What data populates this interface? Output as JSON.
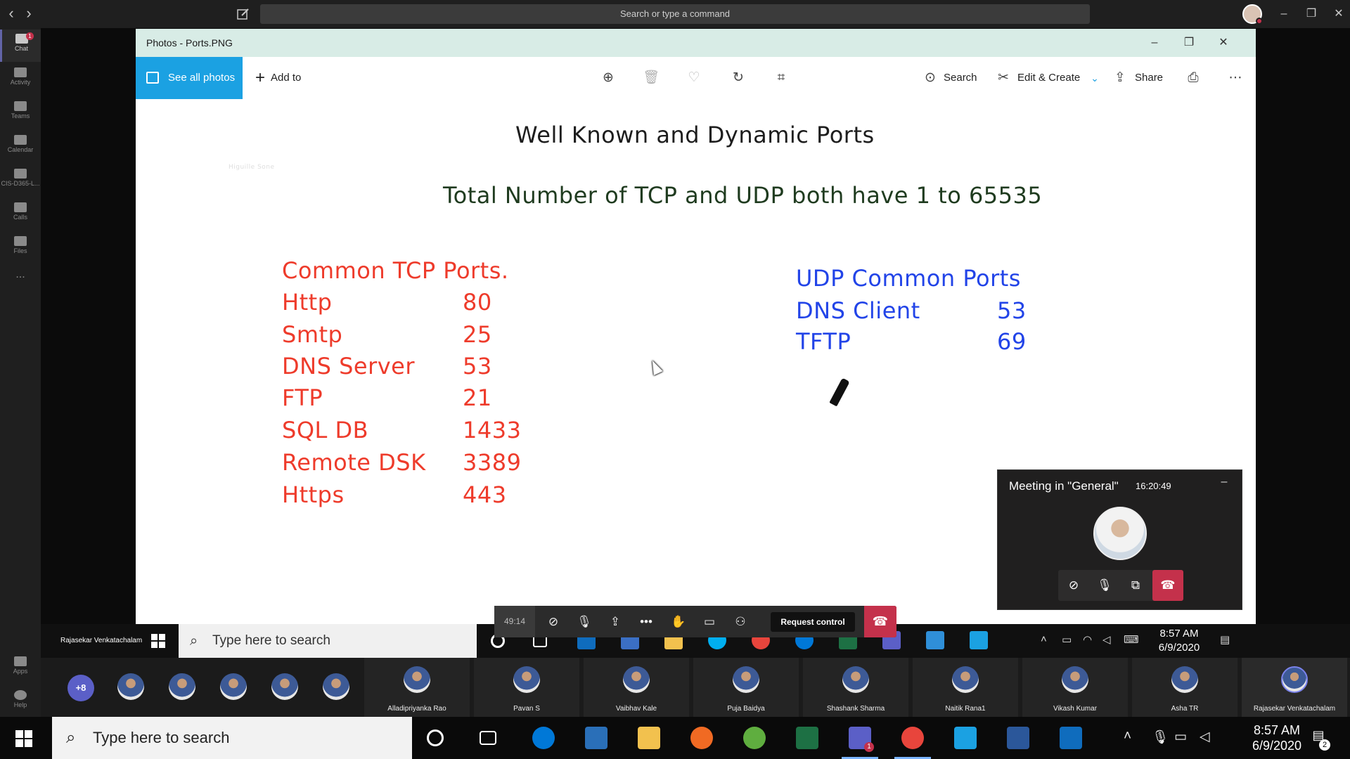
{
  "teams": {
    "command_placeholder": "Search or type a command",
    "rail": [
      {
        "label": "Chat",
        "badge": "1"
      },
      {
        "label": "Activity"
      },
      {
        "label": "Teams"
      },
      {
        "label": "Calendar"
      },
      {
        "label": "CIS-D365-L..."
      },
      {
        "label": "Calls"
      },
      {
        "label": "Files"
      },
      {
        "label": "..."
      },
      {
        "label": "Apps"
      },
      {
        "label": "Help"
      }
    ]
  },
  "photos": {
    "window_title": "Photos - Ports.PNG",
    "see_all": "See all photos",
    "add_to": "Add to",
    "search": "Search",
    "edit_create": "Edit & Create",
    "share": "Share",
    "image": {
      "title": "Well Known and Dynamic Ports",
      "subtitle": "Total Number of TCP and UDP both have 1 to 65535",
      "faint_label": "Higuille Sone",
      "tcp_heading": "Common TCP Ports.",
      "tcp_ports": [
        {
          "name": "Http",
          "port": "80"
        },
        {
          "name": "Smtp",
          "port": "25"
        },
        {
          "name": "DNS Server",
          "port": "53"
        },
        {
          "name": "FTP",
          "port": "21"
        },
        {
          "name": "SQL DB",
          "port": "1433"
        },
        {
          "name": "Remote DSK",
          "port": "3389"
        },
        {
          "name": "Https",
          "port": "443"
        }
      ],
      "udp_heading": "UDP Common Ports",
      "udp_ports": [
        {
          "name": "DNS Client",
          "port": "53"
        },
        {
          "name": "TFTP",
          "port": "69"
        }
      ]
    }
  },
  "meeting": {
    "title": "Meeting in \"General\"",
    "duration": "16:20:49"
  },
  "call_bar": {
    "elapsed": "49:14",
    "request_control": "Request control"
  },
  "inner_taskbar": {
    "user": "Rajasekar Venkatachalam",
    "search_placeholder": "Type here to search",
    "time": "8:57 AM",
    "date": "6/9/2020"
  },
  "participants": {
    "overflow": "+8",
    "named": [
      "Alladipriyanka Rao",
      "Pavan S",
      "Vaibhav Kale",
      "Puja Baidya",
      "Shashank Sharma",
      "Naitik Rana1",
      "Vikash Kumar",
      "Asha TR",
      "Rajasekar Venkatachalam"
    ]
  },
  "host_taskbar": {
    "search_placeholder": "Type here to search",
    "time": "8:57 AM",
    "date": "6/9/2020",
    "notifications": "2",
    "teams_badge": "1"
  },
  "colors": {
    "tcp_text": "#ee3b2b",
    "udp_text": "#2244e8",
    "photos_accent": "#1ba1e2",
    "hangup": "#c4314b",
    "teams_purple": "#5b5fc7"
  }
}
